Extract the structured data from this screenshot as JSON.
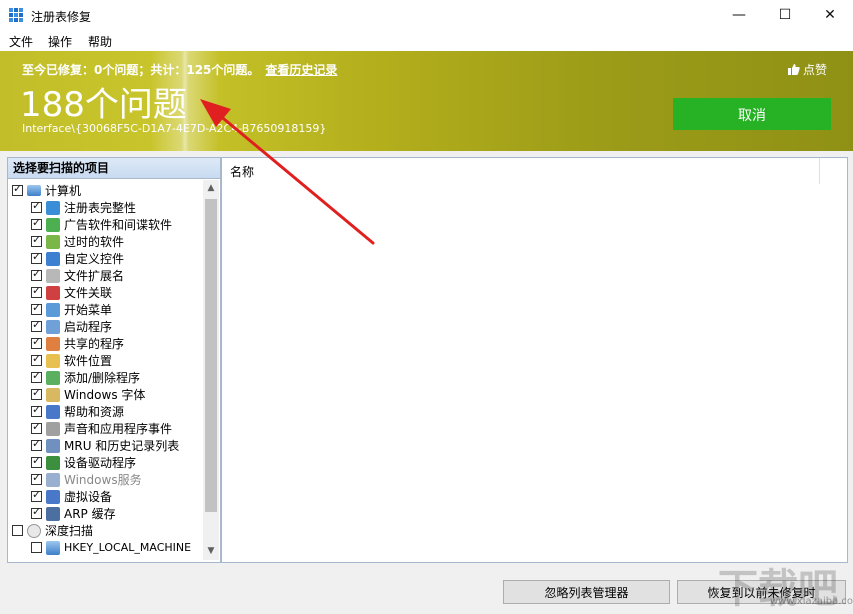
{
  "window": {
    "title": "注册表修复",
    "min": "—",
    "max": "☐",
    "close": "✕"
  },
  "menu": [
    "文件",
    "操作",
    "帮助"
  ],
  "banner": {
    "stats": "至今已修复：0个问题；共计：125个问题。",
    "history_link": "查看历史记录",
    "count": "188个问题",
    "path": "Interface\\{30068F5C-D1A7-4E7D-A2C4-B7650918159}",
    "like": "点赞",
    "cancel": "取消",
    "color_accent": "#27b226"
  },
  "left_panel": {
    "header": "选择要扫描的项目",
    "root": {
      "label": "计算机",
      "checked": true
    },
    "items": [
      {
        "label": "注册表完整性",
        "icon": "registry-icon",
        "checked": true
      },
      {
        "label": "广告软件和间谍软件",
        "icon": "shield-icon",
        "checked": true
      },
      {
        "label": "过时的软件",
        "icon": "trash-icon",
        "checked": true
      },
      {
        "label": "自定义控件",
        "icon": "controls-icon",
        "checked": true
      },
      {
        "label": "文件扩展名",
        "icon": "file-icon",
        "checked": true
      },
      {
        "label": "文件关联",
        "icon": "file-association-icon",
        "checked": true
      },
      {
        "label": "开始菜单",
        "icon": "start-menu-icon",
        "checked": true
      },
      {
        "label": "启动程序",
        "icon": "startup-icon",
        "checked": true
      },
      {
        "label": "共享的程序",
        "icon": "shared-icon",
        "checked": true
      },
      {
        "label": "软件位置",
        "icon": "folder-icon",
        "checked": true
      },
      {
        "label": "添加/删除程序",
        "icon": "recycle-icon",
        "checked": true
      },
      {
        "label": "Windows 字体",
        "icon": "font-icon",
        "checked": true
      },
      {
        "label": "帮助和资源",
        "icon": "help-icon",
        "checked": true
      },
      {
        "label": "声音和应用程序事件",
        "icon": "sound-icon",
        "checked": true
      },
      {
        "label": "MRU 和历史记录列表",
        "icon": "history-icon",
        "checked": true
      },
      {
        "label": "设备驱动程序",
        "icon": "driver-icon",
        "checked": true
      },
      {
        "label": "Windows服务",
        "icon": "service-icon",
        "checked": true
      },
      {
        "label": "虚拟设备",
        "icon": "virtual-device-icon",
        "checked": true
      },
      {
        "label": "ARP 缓存",
        "icon": "arp-icon",
        "checked": true
      }
    ],
    "deep": {
      "label": "深度扫描",
      "checked": false
    },
    "deep_items": [
      {
        "label": "HKEY_LOCAL_MACHINE",
        "checked": false
      }
    ]
  },
  "right_panel": {
    "column_name": "名称"
  },
  "buttons": {
    "ignore_list": "忽略列表管理器",
    "restore": "恢复到以前未修复时"
  },
  "watermark": {
    "text": "下载吧",
    "sub": "www.xiazaiba.com"
  }
}
